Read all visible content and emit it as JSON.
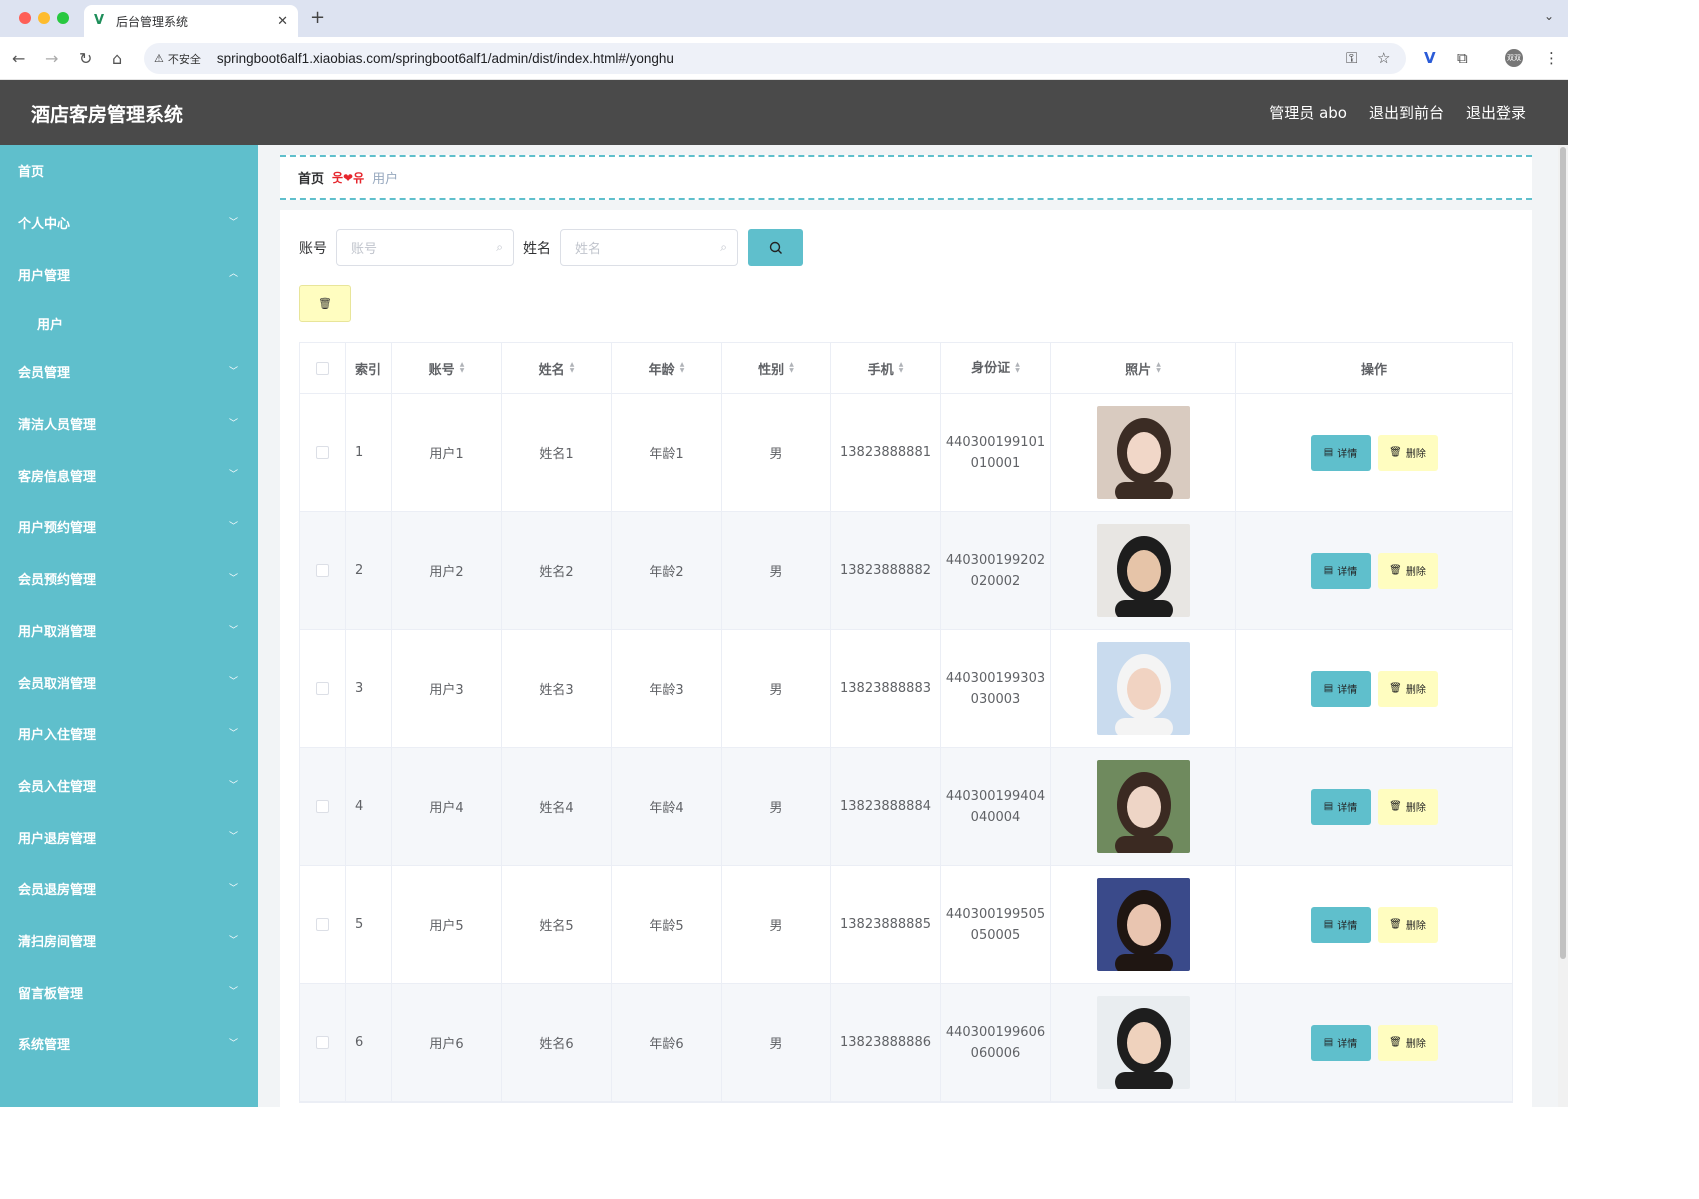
{
  "browser": {
    "tab_title": "后台管理系统",
    "security_label": "不安全",
    "url": "springboot6alf1.xiaobias.com/springboot6alf1/admin/dist/index.html#/yonghu",
    "profile_label": "双双"
  },
  "header": {
    "title": "酒店客房管理系统",
    "admin_label": "管理员 abo",
    "to_front_label": "退出到前台",
    "logout_label": "退出登录"
  },
  "sidebar": {
    "items": [
      {
        "label": "首页"
      },
      {
        "label": "个人中心"
      },
      {
        "label": "用户管理"
      },
      {
        "label": "用户"
      },
      {
        "label": "会员管理"
      },
      {
        "label": "清洁人员管理"
      },
      {
        "label": "客房信息管理"
      },
      {
        "label": "用户预约管理"
      },
      {
        "label": "会员预约管理"
      },
      {
        "label": "用户取消管理"
      },
      {
        "label": "会员取消管理"
      },
      {
        "label": "用户入住管理"
      },
      {
        "label": "会员入住管理"
      },
      {
        "label": "用户退房管理"
      },
      {
        "label": "会员退房管理"
      },
      {
        "label": "清扫房间管理"
      },
      {
        "label": "留言板管理"
      },
      {
        "label": "系统管理"
      }
    ]
  },
  "breadcrumb": {
    "home": "首页",
    "separator": "웃❤유",
    "current": "用户"
  },
  "search": {
    "account_label": "账号",
    "account_placeholder": "账号",
    "name_label": "姓名",
    "name_placeholder": "姓名"
  },
  "table": {
    "headers": [
      "索引",
      "账号",
      "姓名",
      "年龄",
      "性别",
      "手机",
      "身份证",
      "照片",
      "操作"
    ],
    "detail_label": "详情",
    "delete_label": "删除",
    "rows": [
      {
        "index": "1",
        "account": "用户1",
        "name": "姓名1",
        "age": "年龄1",
        "gender": "男",
        "phone": "13823888881",
        "id_a": "440300199101",
        "id_b": "010001"
      },
      {
        "index": "2",
        "account": "用户2",
        "name": "姓名2",
        "age": "年龄2",
        "gender": "男",
        "phone": "13823888882",
        "id_a": "440300199202",
        "id_b": "020002"
      },
      {
        "index": "3",
        "account": "用户3",
        "name": "姓名3",
        "age": "年龄3",
        "gender": "男",
        "phone": "13823888883",
        "id_a": "440300199303",
        "id_b": "030003"
      },
      {
        "index": "4",
        "account": "用户4",
        "name": "姓名4",
        "age": "年龄4",
        "gender": "男",
        "phone": "13823888884",
        "id_a": "440300199404",
        "id_b": "040004"
      },
      {
        "index": "5",
        "account": "用户5",
        "name": "姓名5",
        "age": "年龄5",
        "gender": "男",
        "phone": "13823888885",
        "id_a": "440300199505",
        "id_b": "050005"
      },
      {
        "index": "6",
        "account": "用户6",
        "name": "姓名6",
        "age": "年龄6",
        "gender": "男",
        "phone": "13823888886",
        "id_a": "440300199606",
        "id_b": "060006"
      }
    ]
  },
  "colors": {
    "accent": "#5fbfcc",
    "header_bg": "#4a4a4a",
    "delete_bg": "#fffdc0"
  }
}
